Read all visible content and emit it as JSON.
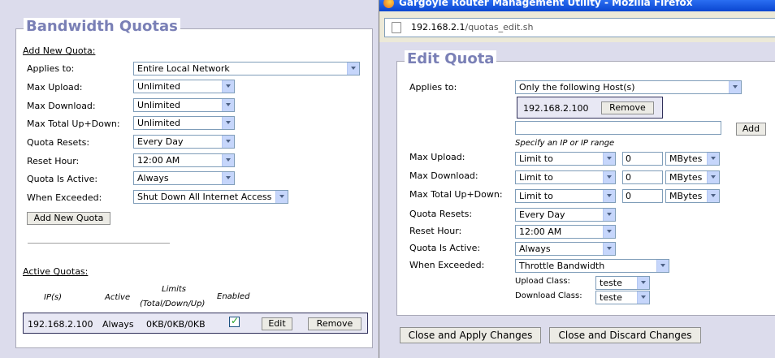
{
  "background_page": {
    "title": "Bandwidth Quotas",
    "add_section_title": "Add New Quota:",
    "fields": [
      {
        "label": "Applies to:",
        "value": "Entire Local Network"
      },
      {
        "label": "Max Upload:",
        "value": "Unlimited"
      },
      {
        "label": "Max Download:",
        "value": "Unlimited"
      },
      {
        "label": "Max Total Up+Down:",
        "value": "Unlimited"
      },
      {
        "label": "Quota Resets:",
        "value": "Every Day"
      },
      {
        "label": "Reset Hour:",
        "value": "12:00 AM"
      },
      {
        "label": "Quota Is Active:",
        "value": "Always"
      },
      {
        "label": "When Exceeded:",
        "value": "Shut Down All Internet Access"
      }
    ],
    "add_button": "Add New Quota",
    "active_section_title": "Active Quotas:",
    "table_headers": {
      "ips": "IP(s)",
      "active": "Active",
      "limits_1": "Limits",
      "limits_2": "(Total/Down/Up)",
      "enabled": "Enabled"
    },
    "row": {
      "ip": "192.168.2.100",
      "active": "Always",
      "limits": "0KB/0KB/0KB",
      "enabled": true,
      "edit_label": "Edit",
      "remove_label": "Remove"
    }
  },
  "popup": {
    "window_title": "Gargoyle Router Management Utility - Mozilla Firefox",
    "url_host": "192.168.2.1",
    "url_path": "/quotas_edit.sh",
    "panel_title": "Edit Quota",
    "applies_to": {
      "label": "Applies to:",
      "value": "Only the following Host(s)"
    },
    "host_entry": {
      "ip": "192.168.2.100",
      "remove_label": "Remove"
    },
    "add_host": {
      "value": "",
      "add_label": "Add",
      "hint": "Specify an IP or IP range"
    },
    "limits": [
      {
        "label": "Max Upload:",
        "mode": "Limit to",
        "amount": "0",
        "unit": "MBytes"
      },
      {
        "label": "Max Download:",
        "mode": "Limit to",
        "amount": "0",
        "unit": "MBytes"
      },
      {
        "label": "Max Total Up+Down:",
        "mode": "Limit to",
        "amount": "0",
        "unit": "MBytes"
      }
    ],
    "quota_resets": {
      "label": "Quota Resets:",
      "value": "Every Day"
    },
    "reset_hour": {
      "label": "Reset Hour:",
      "value": "12:00 AM"
    },
    "quota_active": {
      "label": "Quota Is Active:",
      "value": "Always"
    },
    "when_exceeded": {
      "label": "When Exceeded:",
      "value": "Throttle Bandwidth"
    },
    "upload_class": {
      "label": "Upload Class:",
      "value": "teste"
    },
    "download_class": {
      "label": "Download Class:",
      "value": "teste"
    },
    "apply_button": "Close and Apply Changes",
    "discard_button": "Close and Discard Changes"
  },
  "colors": {
    "legend": "#7a80b6",
    "page_bg": "#dcdcec",
    "titlebar": "#0a46d0"
  }
}
